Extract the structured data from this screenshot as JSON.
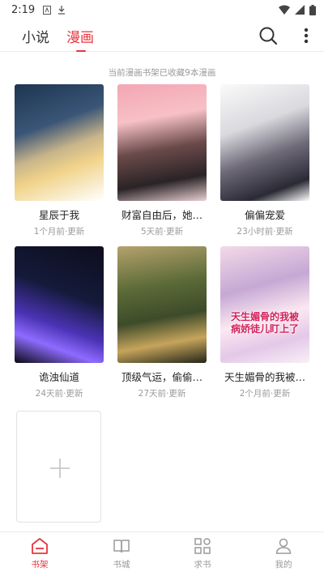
{
  "status_bar": {
    "time": "2:19"
  },
  "header": {
    "tabs": [
      {
        "label": "小说",
        "active": false
      },
      {
        "label": "漫画",
        "active": true
      }
    ],
    "accent_color": "#e8343f"
  },
  "notice": "当前漫画书架已收藏9本漫画",
  "comics": [
    {
      "title": "星辰于我",
      "updated": "1个月前·更新"
    },
    {
      "title": "财富自由后，她…",
      "updated": "5天前·更新"
    },
    {
      "title": "偏偏宠爱",
      "updated": "23小时前·更新"
    },
    {
      "title": "诡浊仙道",
      "updated": "24天前·更新"
    },
    {
      "title": "顶级气运，偷偷…",
      "updated": "27天前·更新"
    },
    {
      "title": "天生媚骨的我被…",
      "updated": "2个月前·更新",
      "cover_text": "天生媚骨的我被病娇徒儿盯上了"
    }
  ],
  "bottom_nav": [
    {
      "label": "书架",
      "icon": "bookshelf-icon",
      "active": true
    },
    {
      "label": "书城",
      "icon": "book-open-icon",
      "active": false
    },
    {
      "label": "求书",
      "icon": "grid-icon",
      "active": false
    },
    {
      "label": "我的",
      "icon": "person-icon",
      "active": false
    }
  ]
}
